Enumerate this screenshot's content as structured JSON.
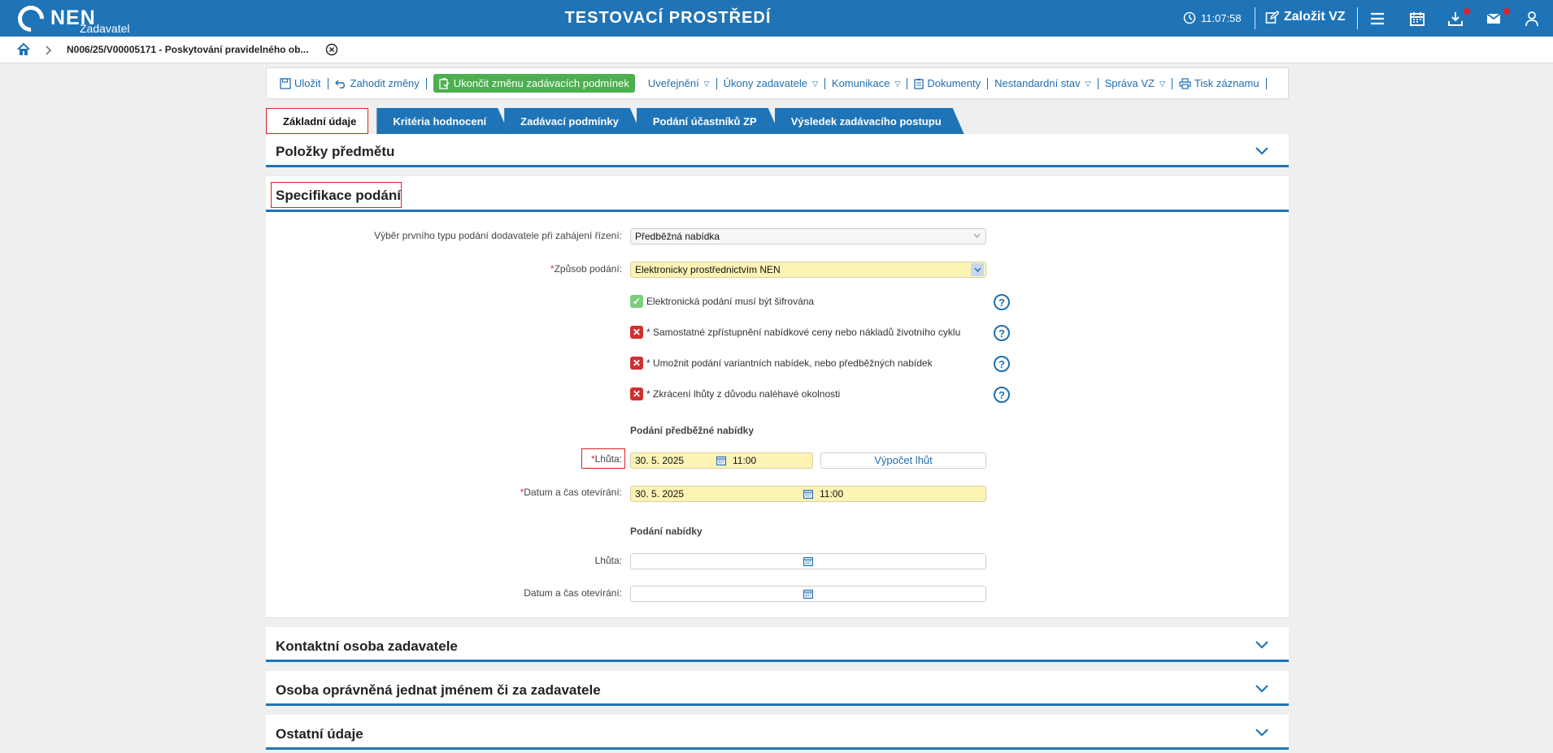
{
  "header": {
    "logo": "NEN",
    "logo_sub": "Zadavatel",
    "env_title": "TESTOVACÍ PROSTŘEDÍ",
    "time": "11:07:58",
    "create_label": "Založit VZ"
  },
  "breadcrumb": {
    "title": "N006/25/V00005171 - Poskytování pravidelného ob..."
  },
  "toolbar": {
    "save": "Uložit",
    "discard": "Zahodit změny",
    "finish": "Ukončit změnu zadávacích podmínek",
    "publish": "Uveřejnění",
    "actions": "Úkony zadavatele",
    "communication": "Komunikace",
    "documents": "Dokumenty",
    "nonstandard": "Nestandardní stav",
    "management": "Správa VZ",
    "print": "Tisk záznamu"
  },
  "tabs": [
    {
      "label": "Základní údaje"
    },
    {
      "label": "Kritéria hodnocení"
    },
    {
      "label": "Zadávací podmínky"
    },
    {
      "label": "Podání účastníků ZP"
    },
    {
      "label": "Výsledek zadávacího postupu"
    }
  ],
  "panels": {
    "items": "Položky předmětu",
    "spec": "Specifikace podání",
    "contact": "Kontaktní osoba zadavatele",
    "authorized": "Osoba oprávněná jednat jménem či za zadavatele",
    "other": "Ostatní údaje"
  },
  "form": {
    "first_type_label": "Výběr prvního typu podání dodavatele při zahájení řízení:",
    "first_type_value": "Předběžná nabídka",
    "method_label": "Způsob podání:",
    "method_value": "Elektronicky prostřednictvím NEN",
    "required_mark": "*",
    "checks": [
      {
        "label": "Elektronická podání musí být šifrována",
        "state": "checked"
      },
      {
        "label": "* Samostatné zpřístupnění nabídkové ceny nebo nákladů životního cyklu",
        "state": "unchecked"
      },
      {
        "label": "* Umožnit podání variantních nabídek, nebo předběžných nabídek",
        "state": "unchecked"
      },
      {
        "label": "* Zkrácení lhůty z důvodu naléhavé okolnosti",
        "state": "unchecked"
      }
    ],
    "preliminary_heading": "Podání předběžné nabídky",
    "deadline_label": "Lhůta:",
    "prelim_deadline_date": "30. 5. 2025",
    "prelim_deadline_time": "11:00",
    "calc_button": "Výpočet lhůt",
    "opening_label": "Datum a čas otevírání:",
    "prelim_opening_date": "30. 5. 2025",
    "prelim_opening_time": "11:00",
    "offer_heading": "Podání nabídky",
    "offer_deadline_label": "Lhůta:",
    "offer_opening_label": "Datum a čas otevírání:"
  },
  "colors": {
    "brand": "#1f74b8",
    "green": "#4caf50",
    "required_field": "#fdf3b5",
    "error": "#d03030"
  }
}
